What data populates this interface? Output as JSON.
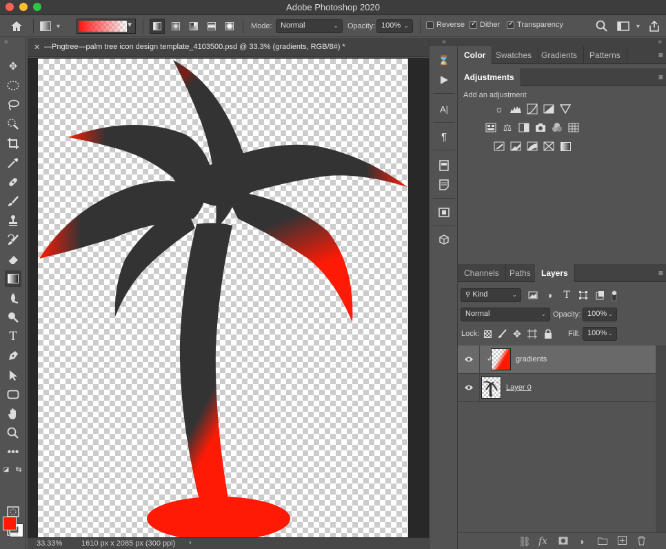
{
  "app": {
    "title": "Adobe Photoshop 2020"
  },
  "options_bar": {
    "mode_label": "Mode:",
    "mode_value": "Normal",
    "opacity_label": "Opacity:",
    "opacity_value": "100%",
    "reverse_label": "Reverse",
    "reverse_checked": false,
    "dither_label": "Dither",
    "dither_checked": true,
    "transparency_label": "Transparency",
    "transparency_checked": true,
    "gradient_color": "#ff1414"
  },
  "document": {
    "tab_title": "—Pngtree—palm tree icon design template_4103500.psd @ 33.3% (gradients, RGB/8#) *",
    "zoom": "33.33%",
    "doc_size": "1610 px x 2085 px (300 ppi)"
  },
  "colors": {
    "foreground": "#ff1a05",
    "background": "#ffffff",
    "tree": "#333333",
    "tree_accent": "#ff1a05"
  },
  "top_panel": {
    "tabs": [
      "Color",
      "Swatches",
      "Gradients",
      "Patterns"
    ],
    "active_tab": "Color"
  },
  "adjustments": {
    "tab": "Adjustments",
    "prompt": "Add an adjustment",
    "icons": [
      "brightness-contrast",
      "levels",
      "curves",
      "exposure",
      "vibrance",
      "hue-saturation",
      "color-balance",
      "black-white",
      "photo-filter",
      "channel-mixer",
      "color-lookup",
      "invert",
      "posterize",
      "threshold",
      "selective-color",
      "gradient-map"
    ]
  },
  "layers_panel": {
    "tabs": [
      "Channels",
      "Paths",
      "Layers"
    ],
    "active_tab": "Layers",
    "kind_label": "Kind",
    "blend_mode": "Normal",
    "opacity_label": "Opacity:",
    "opacity_value": "100%",
    "lock_label": "Lock:",
    "fill_label": "Fill:",
    "fill_value": "100%",
    "layers": [
      {
        "name": "gradients",
        "selected": true,
        "clipped": true
      },
      {
        "name": "Layer 0",
        "selected": false,
        "clipped": false
      }
    ]
  }
}
